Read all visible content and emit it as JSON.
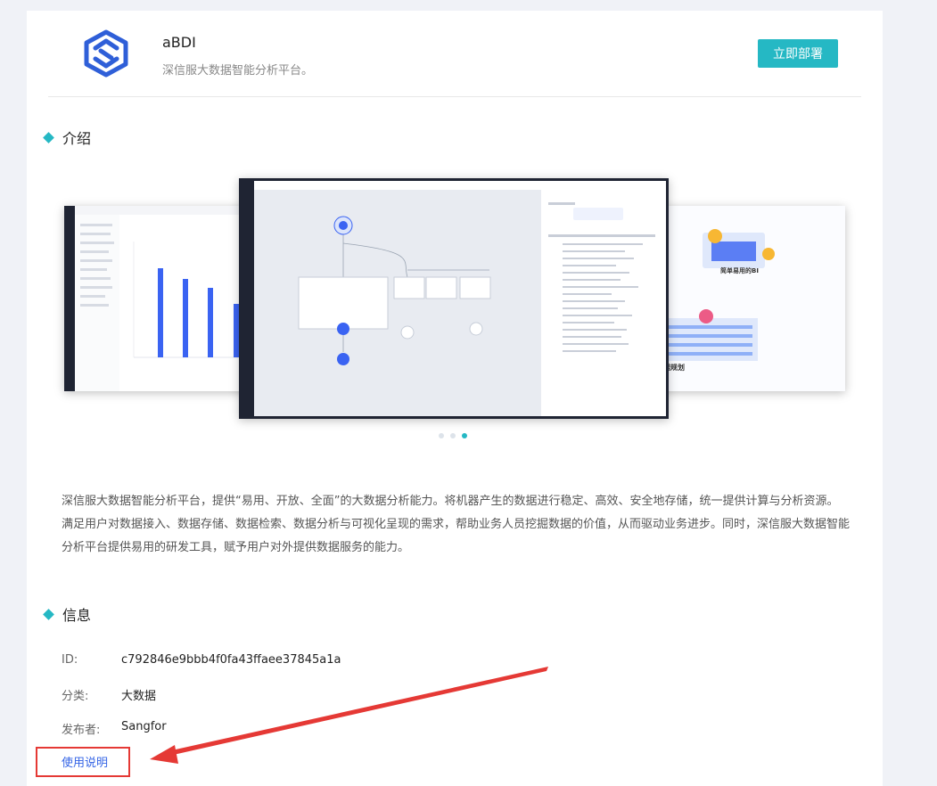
{
  "app": {
    "name": "aBDI",
    "subtitle": "深信服大数据智能分析平台。",
    "deploy_label": "立即部署"
  },
  "intro": {
    "title": "介绍",
    "description": "深信服大数据智能分析平台，提供“易用、开放、全面”的大数据分析能力。将机器产生的数据进行稳定、高效、安全地存储，统一提供计算与分析资源。 满足用户对数据接入、数据存储、数据检索、数据分析与可视化呈现的需求，帮助业务人员挖掘数据的价值，从而驱动业务进步。同时，深信服大数据智能分析平台提供易用的研发工具，赋予用户对外提供数据服务的能力。"
  },
  "carousel": {
    "slide_count": 3,
    "active_index": 2,
    "right_slide_captions": [
      "简单易用的BI",
      "视化数据规划"
    ]
  },
  "info": {
    "title": "信息",
    "rows": [
      {
        "label": "ID:",
        "value": "c792846e9bbb4f0fa43ffaee37845a1a"
      },
      {
        "label": "分类:",
        "value": "大数据"
      },
      {
        "label": "发布者:",
        "value": "Sangfor"
      }
    ],
    "usage_link": "使用说明"
  },
  "colors": {
    "accent": "#25b8c4",
    "link": "#3565e6",
    "annotation": "#e53935",
    "logo": "#2f5fd8"
  },
  "icons": [
    "app-logo-icon",
    "diamond-bullet-icon",
    "annotation-arrow-icon"
  ]
}
